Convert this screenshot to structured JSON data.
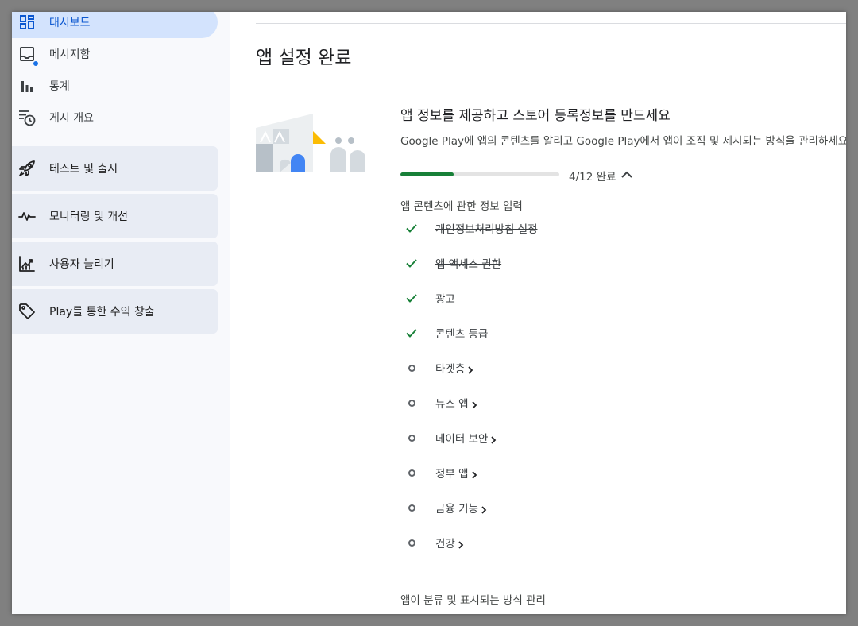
{
  "sidebar": {
    "nav": [
      {
        "label": "대시보드",
        "icon": "dashboard-icon",
        "active": true
      },
      {
        "label": "메시지함",
        "icon": "inbox-icon",
        "badge": true
      },
      {
        "label": "통계",
        "icon": "bar-chart-icon"
      },
      {
        "label": "게시 개요",
        "icon": "publishing-overview-icon"
      }
    ],
    "sections": [
      {
        "label": "테스트 및 출시",
        "icon": "rocket-icon"
      },
      {
        "label": "모니터링 및 개선",
        "icon": "vitals-icon"
      },
      {
        "label": "사용자 늘리기",
        "icon": "grow-users-icon"
      },
      {
        "label": "Play를 통한 수익 창출",
        "icon": "tag-icon"
      }
    ]
  },
  "main": {
    "title": "앱 설정 완료",
    "card": {
      "title": "앱 정보를 제공하고 스토어 등록정보를 만드세요",
      "description": "Google Play에 앱의 콘텐츠를 알리고 Google Play에서 앱이 조직 및 제시되는 방식을 관리하세요",
      "progress": {
        "completed": 4,
        "total": 12,
        "label": "4/12 완료"
      }
    },
    "groups": [
      {
        "title": "앱 콘텐츠에 관한 정보 입력",
        "steps": [
          {
            "label": "개인정보처리방침 설정",
            "status": "done"
          },
          {
            "label": "앱 액세스 권한",
            "status": "done"
          },
          {
            "label": "광고",
            "status": "done"
          },
          {
            "label": "콘텐츠 등급",
            "status": "done"
          },
          {
            "label": "타겟층",
            "status": "todo"
          },
          {
            "label": "뉴스 앱",
            "status": "todo"
          },
          {
            "label": "데이터 보안",
            "status": "todo"
          },
          {
            "label": "정부 앱",
            "status": "todo"
          },
          {
            "label": "금융 기능",
            "status": "todo"
          },
          {
            "label": "건강",
            "status": "todo"
          }
        ]
      },
      {
        "title": "앱이 분류 및 표시되는 방식 관리",
        "steps": []
      }
    ]
  },
  "colors": {
    "accent": "#0b57d0",
    "active_bg": "#d3e3fd",
    "success": "#188038",
    "section_bg": "#e8ecf4",
    "badge": "#1a73e8"
  }
}
